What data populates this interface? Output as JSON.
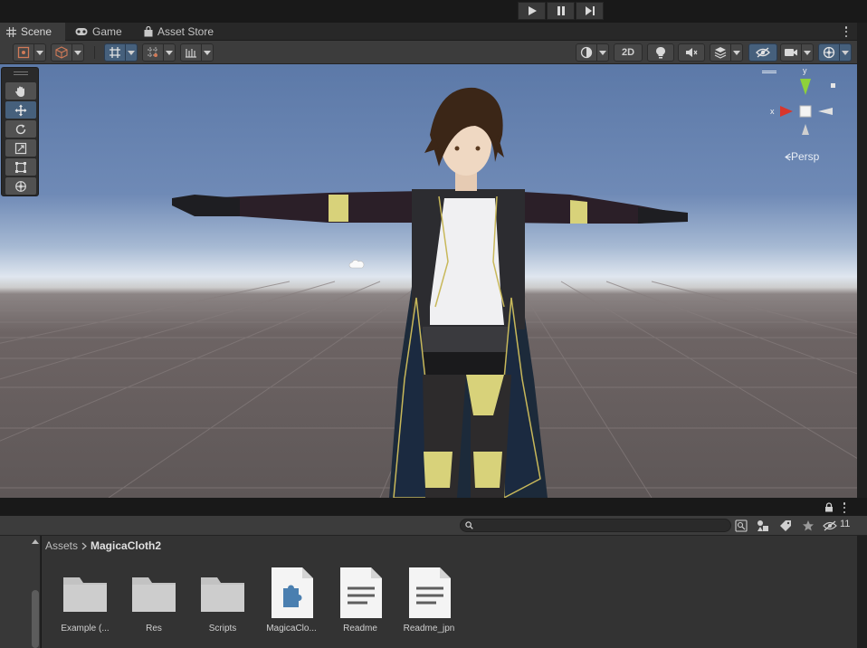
{
  "tabs": [
    {
      "label": "Scene",
      "icon": "grid-icon"
    },
    {
      "label": "Game",
      "icon": "gamepad-icon"
    },
    {
      "label": "Asset Store",
      "icon": "shopping-bag-icon"
    }
  ],
  "play_controls": [
    {
      "name": "play-button",
      "icon": "play-icon"
    },
    {
      "name": "pause-button",
      "icon": "pause-icon"
    },
    {
      "name": "step-button",
      "icon": "step-icon"
    }
  ],
  "scene_toolbar": {
    "view_2d_label": "2D"
  },
  "gizmo": {
    "y_label": "y",
    "x_label": "x",
    "projection_label": "Persp",
    "axis_colors": {
      "x": "#d8362c",
      "y": "#8ed13a",
      "z": "#e8e8e8"
    }
  },
  "tools": [
    {
      "name": "view-tool",
      "icon": "hand-icon",
      "active": false
    },
    {
      "name": "move-tool",
      "icon": "move-icon",
      "active": true
    },
    {
      "name": "rotate-tool",
      "icon": "rotate-icon",
      "active": false
    },
    {
      "name": "scale-tool",
      "icon": "scale-icon",
      "active": false
    },
    {
      "name": "rect-tool",
      "icon": "rect-icon",
      "active": false
    },
    {
      "name": "transform-tool",
      "icon": "transform-icon",
      "active": false
    }
  ],
  "project": {
    "search_value": "",
    "hidden_count": "11",
    "breadcrumb": [
      "Assets",
      "MagicaCloth2"
    ],
    "assets": [
      {
        "label": "Example (...",
        "kind": "folder",
        "icon": "folder-icon"
      },
      {
        "label": "Res",
        "kind": "folder",
        "icon": "folder-icon"
      },
      {
        "label": "Scripts",
        "kind": "folder",
        "icon": "folder-icon"
      },
      {
        "label": "MagicaClo...",
        "kind": "package",
        "icon": "puzzle-icon"
      },
      {
        "label": "Readme",
        "kind": "document",
        "icon": "document-icon"
      },
      {
        "label": "Readme_jpn",
        "kind": "document",
        "icon": "document-icon"
      }
    ]
  },
  "colors": {
    "accent_blue": "#46607c",
    "editor_bg": "#3c3c3c",
    "sky_top": "#5c79a8",
    "ground": "#6d6464"
  }
}
